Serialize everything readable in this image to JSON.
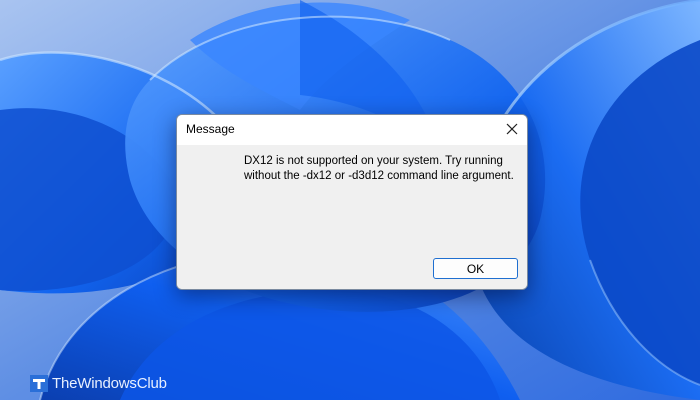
{
  "dialog": {
    "title": "Message",
    "close_icon": "close-icon",
    "message": "DX12 is not supported on your system. Try running without the -dx12 or -d3d12 command line argument.",
    "ok_label": "OK"
  },
  "watermark": {
    "text": "TheWindowsClub",
    "logo_icon": "windows-club-logo"
  },
  "colors": {
    "wallpaper_base": "#6a98e6",
    "wallpaper_accent": "#0a55e0",
    "dialog_bg": "#f0f0f0",
    "button_border": "#1f6fd0"
  }
}
